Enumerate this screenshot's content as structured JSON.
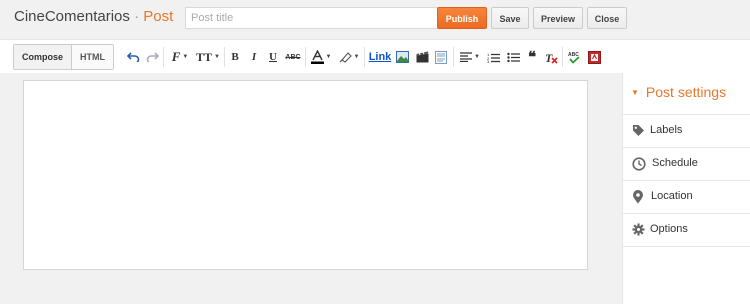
{
  "header": {
    "blog_name": "CineComentarios",
    "separator": "·",
    "section": "Post",
    "title_placeholder": "Post title",
    "title_value": ""
  },
  "buttons": {
    "publish": "Publish",
    "save": "Save",
    "preview": "Preview",
    "close": "Close"
  },
  "toolbar": {
    "compose": "Compose",
    "html": "HTML",
    "bold": "B",
    "italic": "I",
    "underline": "U",
    "strike": "ABC",
    "link": "Link",
    "quote": "❝"
  },
  "sidebar": {
    "heading": "Post settings",
    "items": [
      {
        "label": "Labels",
        "icon": "tag-icon"
      },
      {
        "label": "Schedule",
        "icon": "clock-icon"
      },
      {
        "label": "Location",
        "icon": "map-pin-icon"
      },
      {
        "label": "Options",
        "icon": "gear-icon"
      }
    ]
  },
  "colors": {
    "accent": "#e8782a",
    "publish": "#ee6a22",
    "link": "#1155cc"
  }
}
